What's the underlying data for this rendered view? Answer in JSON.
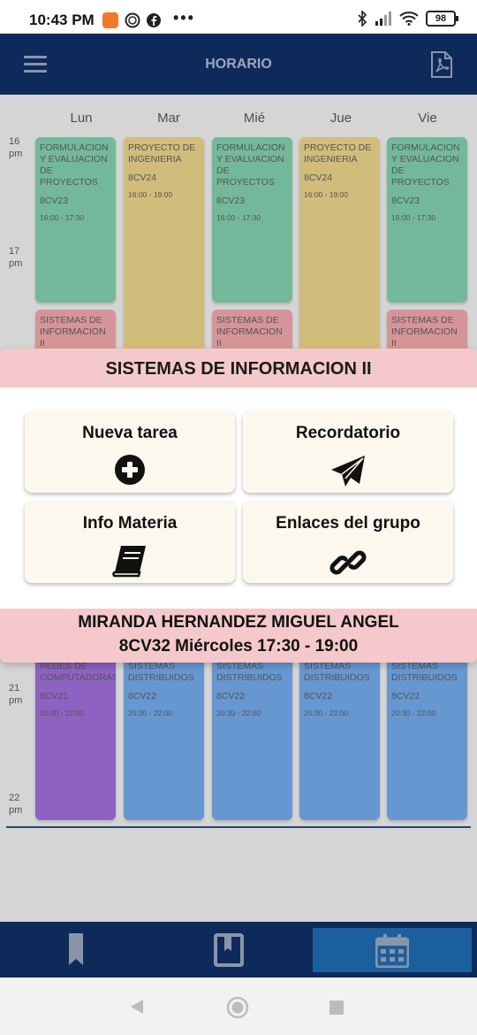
{
  "status_bar": {
    "time": "10:43 PM",
    "dots": "•••",
    "battery": "98"
  },
  "app_bar": {
    "title": "HORARIO"
  },
  "schedule": {
    "days": [
      "Lun",
      "Mar",
      "Mié",
      "Jue",
      "Vie"
    ],
    "hours": [
      {
        "h": "16",
        "p": "pm"
      },
      {
        "h": "17",
        "p": "pm"
      },
      {
        "h": "21",
        "p": "pm"
      },
      {
        "h": "22",
        "p": "pm"
      }
    ],
    "classes": [
      {
        "name": "FORMULACION Y EVALUACION DE PROYECTOS",
        "group": "8CV23",
        "time": "16:00 - 17:30",
        "color": "#7ec8aa"
      },
      {
        "name": "PROYECTO DE INGENIERIA",
        "group": "8CV24",
        "time": "16:00 - 19:00",
        "color": "#e3cd86"
      },
      {
        "name": "FORMULACION Y EVALUACION DE PROYECTOS",
        "group": "8CV23",
        "time": "16:00 - 17:30",
        "color": "#7ec8aa"
      },
      {
        "name": "PROYECTO DE INGENIERIA",
        "group": "8CV24",
        "time": "16:00 - 19:00",
        "color": "#e3cd86"
      },
      {
        "name": "FORMULACION Y EVALUACION DE PROYECTOS",
        "group": "8CV23",
        "time": "16:00 - 17:30",
        "color": "#7ec8aa"
      },
      {
        "name": "SISTEMAS DE INFORMACION II",
        "color": "#e8a2a5"
      },
      {
        "name": "SISTEMAS DE INFORMACION II",
        "color": "#e8a2a5"
      },
      {
        "name": "SISTEMAS DE INFORMACION II",
        "color": "#e8a2a5"
      },
      {
        "name": "REDES DE COMPUTADORAS",
        "group": "8CV21",
        "time": "20:30 - 22:00",
        "color": "#9a6bd3"
      },
      {
        "name": "SISTEMAS DISTRIBUIDOS",
        "group": "8CV22",
        "time": "20:30 - 22:00",
        "color": "#6fa4e3"
      },
      {
        "name": "SISTEMAS DISTRIBUIDOS",
        "group": "8CV22",
        "time": "20:30 - 22:00",
        "color": "#6fa4e3"
      },
      {
        "name": "SISTEMAS DISTRIBUIDOS",
        "group": "8CV22",
        "time": "20:30 - 22:00",
        "color": "#6fa4e3"
      },
      {
        "name": "SISTEMAS DISTRIBUIDOS",
        "group": "8CV22",
        "time": "20:30 - 22:00",
        "color": "#6fa4e3"
      }
    ]
  },
  "popup": {
    "title": "SISTEMAS DE INFORMACION II",
    "actions": [
      {
        "label": "Nueva tarea",
        "icon": "plus-circle-icon"
      },
      {
        "label": "Recordatorio",
        "icon": "paper-plane-icon"
      },
      {
        "label": "Info Materia",
        "icon": "book-icon"
      },
      {
        "label": "Enlaces del grupo",
        "icon": "link-icon"
      }
    ],
    "teacher": "MIRANDA HERNANDEZ MIGUEL ANGEL",
    "info": "8CV32  Miércoles  17:30 - 19:00"
  },
  "bottom_nav": {
    "items": [
      {
        "icon": "bookmark-icon"
      },
      {
        "icon": "notebook-icon"
      },
      {
        "icon": "calendar-icon",
        "active": true
      }
    ]
  },
  "colors": {
    "app_bar": "#0e2a5a",
    "popup_accent": "#f5c9cc",
    "active_nav": "#1b5f9f"
  }
}
